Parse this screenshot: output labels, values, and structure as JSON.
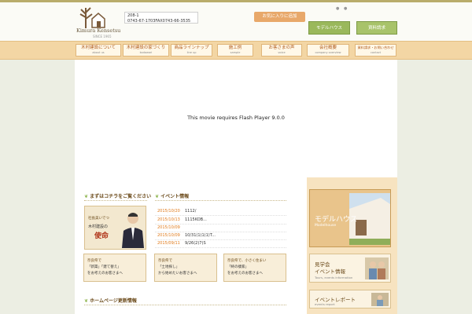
{
  "header": {
    "logo_text": "Kimura Kensetsu",
    "logo_sub": "SINCE 1965",
    "address_line1": "208-1",
    "address_line2": "0743-67-1703FAX0743-66-3535",
    "favorite_label": "お気に入りに追加",
    "model_label": "モデルハウス",
    "document_label": "資料請求"
  },
  "nav": {
    "items": [
      {
        "jp": "木村建設について",
        "en": "about us"
      },
      {
        "jp": "木村建設の家づくり",
        "en": "kodawari"
      },
      {
        "jp": "商品ラインナップ",
        "en": "line up"
      },
      {
        "jp": "施工例",
        "en": "sample"
      },
      {
        "jp": "お客さまの声",
        "en": "voice"
      },
      {
        "jp": "会社概要",
        "en": "company overview"
      },
      {
        "jp": "資料請求・お問い合わせ",
        "en": "contact"
      }
    ]
  },
  "flash": {
    "message": "This movie requires Flash Player 9.0.0"
  },
  "sections": {
    "intro_heading": "まずはコチラをご覧ください",
    "events_heading": "イベント情報",
    "updates_heading": "ホームページ更新情報"
  },
  "feature": {
    "line1": "社長美いでつ",
    "line2": "木村建設の",
    "line3": "使命"
  },
  "events": [
    {
      "date": "2015/10/20",
      "title": "1112/"
    },
    {
      "date": "2015/10/13",
      "title": "1115KOB..."
    },
    {
      "date": "2015/10/09",
      "title": ""
    },
    {
      "date": "2015/10/09",
      "title": "10/31(1)1(1)T..."
    },
    {
      "date": "2015/09/11",
      "title": "9/26(2)7(S"
    }
  ],
  "banners": [
    {
      "l1": "奈良県で",
      "l2": "「新築」「建て替え」",
      "l3": "をお考えのお客さまへ"
    },
    {
      "l1": "奈良県で",
      "l2": "「土地探し」",
      "l3": "から始めたいお客さまへ"
    },
    {
      "l1": "奈良県で、小さく住まい",
      "l2": "「終の棲家」",
      "l3": "をお考えのお客さまへ"
    }
  ],
  "sidebar": {
    "model_title": "モデルハウス",
    "model_sub": "Modelhouse",
    "tour_title1": "見学会",
    "tour_title2": "イベント情報",
    "tour_sub": "Tours, events information",
    "report_title": "イベントレポート",
    "report_sub": "events report"
  },
  "colors": {
    "nav_bg": "#f3d6a4",
    "accent_green": "#9ab85b",
    "event_date": "#e07a1a"
  }
}
